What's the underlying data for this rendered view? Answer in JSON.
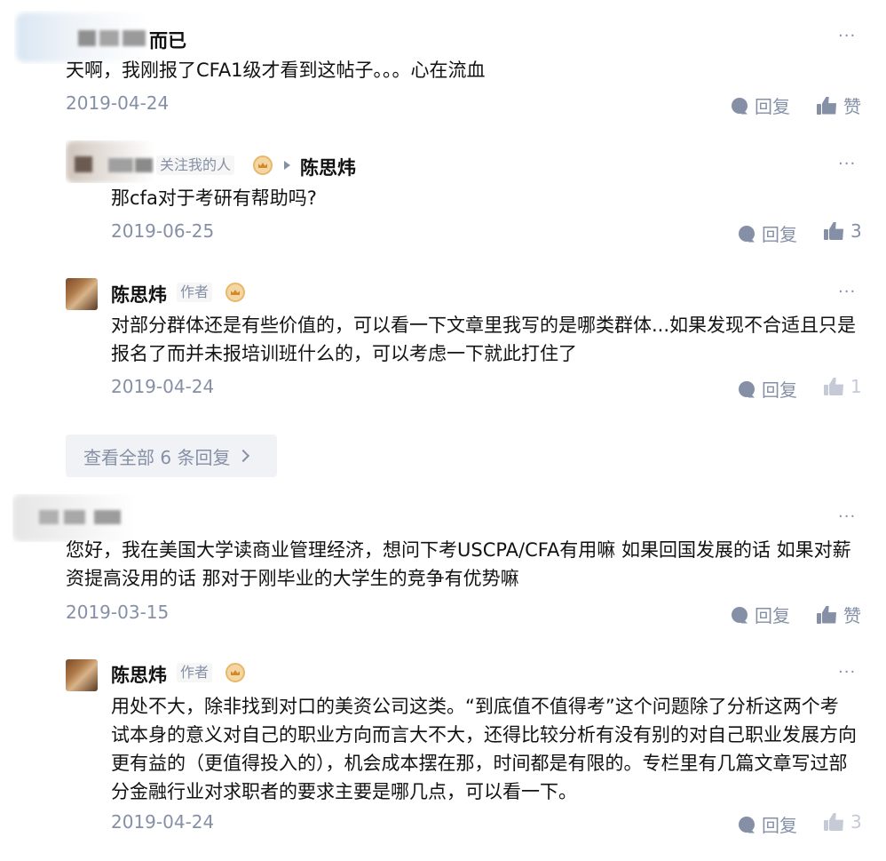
{
  "comments": [
    {
      "author": "而已",
      "content": "天啊，我刚报了CFA1级才看到这帖子。。。心在流血",
      "date": "2019-04-24",
      "reply_label": "回复",
      "like_label": "赞",
      "more": "···"
    },
    {
      "author": "陈思炜",
      "tag": "关注我的人",
      "reply_to": "陈思炜",
      "content": "那cfa对于考研有帮助吗?",
      "date": "2019-06-25",
      "reply_label": "回复",
      "like_label": "3",
      "more": "···"
    },
    {
      "author": "陈思炜",
      "tag": "作者",
      "content": "对部分群体还是有些价值的，可以看一下文章里我写的是哪类群体...如果发现不合适且只是报名了而并未报培训班什么的，可以考虑一下就此打住了",
      "date": "2019-04-24",
      "reply_label": "回复",
      "like_label": "1",
      "more": "···"
    },
    {
      "author": "",
      "content": "您好，我在美国大学读商业管理经济，想问下考USCPA/CFA有用嘛 如果回国发展的话 如果对薪资提高没用的话 那对于刚毕业的大学生的竞争有优势嘛",
      "date": "2019-03-15",
      "reply_label": "回复",
      "like_label": "赞",
      "more": "···"
    },
    {
      "author": "陈思炜",
      "tag": "作者",
      "content": "用处不大，除非找到对口的美资公司这类。“到底值不值得考”这个问题除了分析这两个考试本身的意义对自己的职业方向而言大不大，还得比较分析有没有别的对自己职业发展方向更有益的（更值得投入的），机会成本摆在那，时间都是有限的。专栏里有几篇文章写过部分金融行业对求职者的要求主要是哪几点，可以看一下。",
      "date": "2019-04-24",
      "reply_label": "回复",
      "like_label": "3",
      "more": "···"
    }
  ],
  "view_all": "查看全部 6 条回复",
  "icons": {
    "reply": "reply-bubble-icon",
    "like": "thumbs-up-icon",
    "more": "more-dots-icon",
    "badge": "crown-badge-icon",
    "arrow": "reply-arrow-icon",
    "chevron": "chevron-right-icon"
  },
  "colors": {
    "text": "#121212",
    "meta": "#8590a6",
    "button_bg": "#f1f2f5"
  }
}
